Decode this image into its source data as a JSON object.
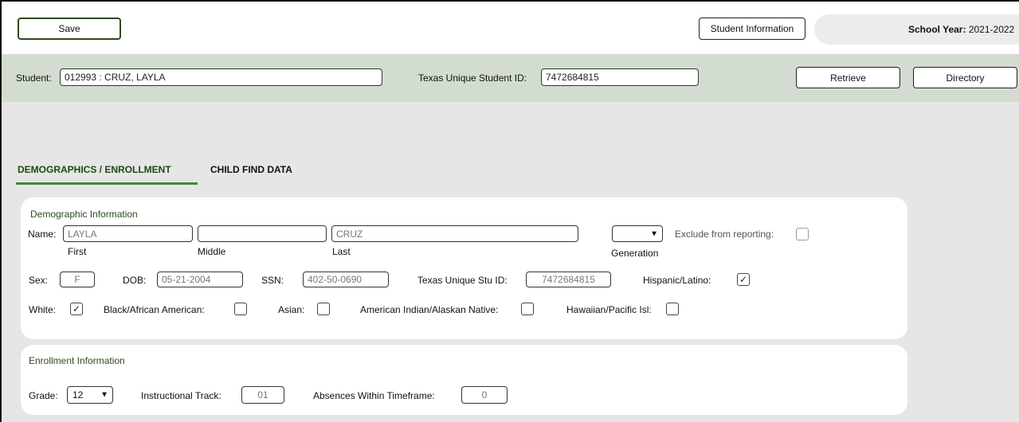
{
  "toolbar": {
    "save_label": "Save",
    "student_info_label": "Student Information",
    "school_year_label": "School Year:",
    "school_year_value": "2021-2022"
  },
  "student_bar": {
    "student_label": "Student:",
    "student_value": "012993 : CRUZ, LAYLA",
    "tsid_label": "Texas Unique Student ID:",
    "tsid_value": "7472684815",
    "retrieve_label": "Retrieve",
    "directory_label": "Directory"
  },
  "tabs": [
    {
      "label": "DEMOGRAPHICS / ENROLLMENT",
      "active": true
    },
    {
      "label": "CHILD FIND DATA",
      "active": false
    }
  ],
  "demographic": {
    "title": "Demographic Information",
    "name_label": "Name:",
    "first_value": "LAYLA",
    "middle_value": "",
    "last_value": "CRUZ",
    "first_caption": "First",
    "middle_caption": "Middle",
    "last_caption": "Last",
    "generation_caption": "Generation",
    "generation_value": "",
    "exclude_label": "Exclude from reporting:",
    "exclude_checked": false,
    "sex_label": "Sex:",
    "sex_value": "F",
    "dob_label": "DOB:",
    "dob_value": "05-21-2004",
    "ssn_label": "SSN:",
    "ssn_value": "402-50-0690",
    "tx_stu_id_label": "Texas Unique Stu ID:",
    "tx_stu_id_value": "7472684815",
    "hispanic_label": "Hispanic/Latino:",
    "hispanic_checked": true,
    "white_label": "White:",
    "white_checked": true,
    "black_label": "Black/African American:",
    "black_checked": false,
    "asian_label": "Asian:",
    "asian_checked": false,
    "amind_label": "American Indian/Alaskan Native:",
    "amind_checked": false,
    "hawaiian_label": "Hawaiian/Pacific Isl:",
    "hawaiian_checked": false,
    "check_glyph": "✓"
  },
  "enrollment": {
    "title": "Enrollment Information",
    "grade_label": "Grade:",
    "grade_value": "12",
    "track_label": "Instructional Track:",
    "track_value": "01",
    "absences_label": "Absences Within Timeframe:",
    "absences_value": "0"
  },
  "colors": {
    "background": "#e6e6e6",
    "student_bar": "#d3dcd0",
    "active_tab_underline": "#3b8a3e",
    "section_title": "#2d4a22"
  },
  "icons": {
    "dropdown": "chevron-down-icon",
    "checkmark": "check-icon"
  }
}
